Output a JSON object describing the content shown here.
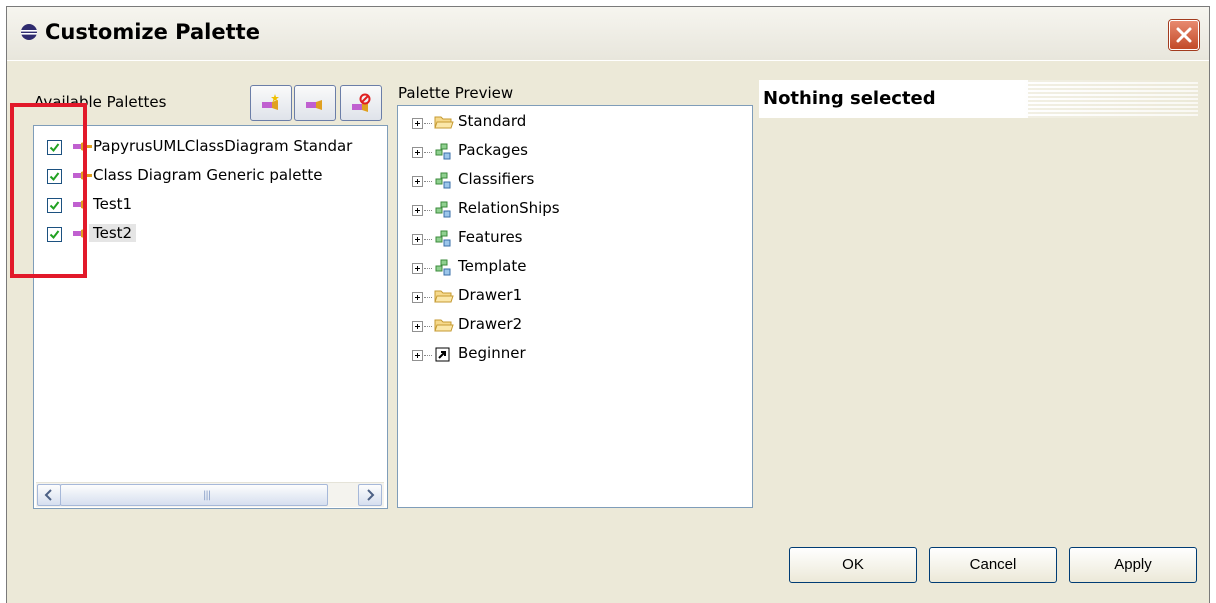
{
  "window": {
    "title": "Customize Palette"
  },
  "available": {
    "label": "Available Palettes",
    "items": [
      {
        "label": "PapyrusUMLClassDiagram Standar",
        "checked": true
      },
      {
        "label": "Class Diagram Generic palette",
        "checked": true
      },
      {
        "label": "Test1",
        "checked": true
      },
      {
        "label": "Test2",
        "checked": true,
        "selected": true
      }
    ],
    "toolbar": [
      "new-palette-icon",
      "edit-palette-icon",
      "delete-palette-icon"
    ]
  },
  "preview": {
    "label": "Palette Preview",
    "items": [
      {
        "label": "Standard",
        "icon": "folder-icon"
      },
      {
        "label": "Packages",
        "icon": "stack-icon"
      },
      {
        "label": "Classifiers",
        "icon": "stack-icon"
      },
      {
        "label": "RelationShips",
        "icon": "stack-icon"
      },
      {
        "label": "Features",
        "icon": "stack-icon"
      },
      {
        "label": "Template",
        "icon": "stack-icon"
      },
      {
        "label": "Drawer1",
        "icon": "folder-icon"
      },
      {
        "label": "Drawer2",
        "icon": "folder-icon"
      },
      {
        "label": "Beginner",
        "icon": "shortcut-icon"
      }
    ]
  },
  "details": {
    "header": "Nothing selected"
  },
  "buttons": {
    "ok": "OK",
    "cancel": "Cancel",
    "apply": "Apply"
  },
  "colors": {
    "highlight": "#e2192a",
    "border": "#7f9db9",
    "dialog_bg": "#ece9d8"
  }
}
